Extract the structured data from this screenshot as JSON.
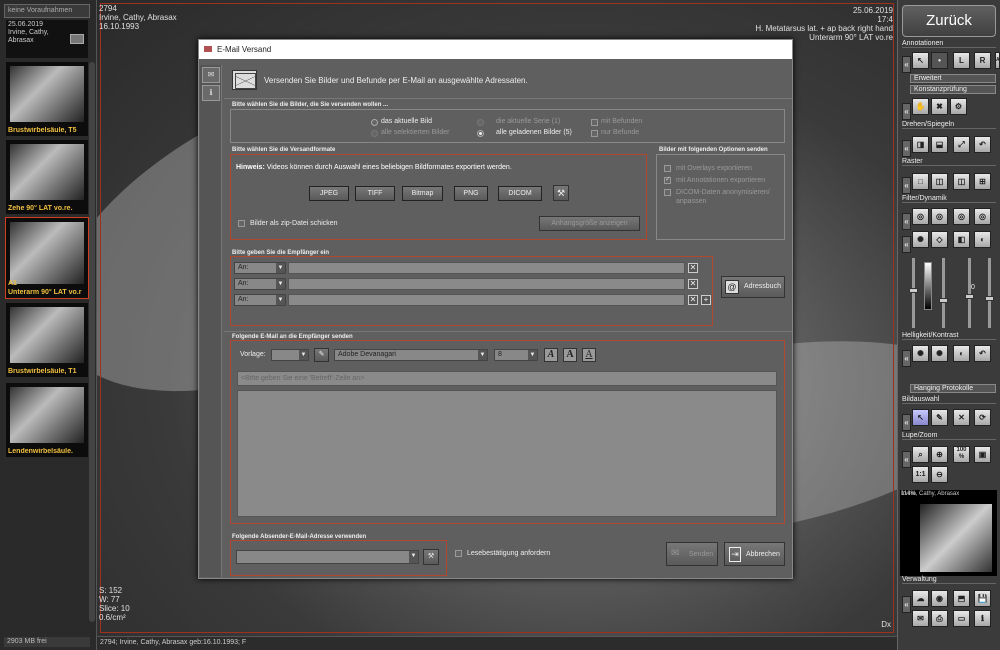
{
  "left": {
    "topbar": "keine Voraufnahmen",
    "patient_date": "25.06.2019",
    "patient_name": "Irvine, Cathy,",
    "patient_name2": "Abrasax",
    "thumbs": [
      {
        "label": "Brustwirbelsäule, T5"
      },
      {
        "label": "Zehe 90° LAT vo.re."
      },
      {
        "label": "Unterarm 90° LAT vo.r"
      },
      {
        "label": "Brustwirbelsäule, T1"
      },
      {
        "label": "Lendenwirbelsäule."
      }
    ],
    "thumb_a1": "A1",
    "free": "2903 MB frei"
  },
  "viewer": {
    "tl1": "2794",
    "tl2": "Irvine, Cathy, Abrasax",
    "tl3": "16.10.1993",
    "tr1": "25.06.2019",
    "tr2": "17:4",
    "tr3": "H. Metatarsus lat. + ap back right hand",
    "tr4": "Unterarm 90° LAT vo.re",
    "bl1": "S: 152",
    "bl2": "W: 77",
    "bl3": "Slice: 10",
    "bl4": "0.6/cm²",
    "br": "Dx"
  },
  "statusbar": "2794; Irvine, Cathy, Abrasax geb:16.10.1993; F",
  "right": {
    "back": "Zurück",
    "annotationen": "Annotationen",
    "erweitert": "Erweitert",
    "konstanz": "Konstanzprüfung",
    "drehen": "Drehen/Spiegeln",
    "raster": "Raster",
    "filter": "Filter/Dynamik",
    "slider_val": "0",
    "helligkeit": "Helligkeit/Kontrast",
    "hanging": "Hanging Protokolle",
    "bildauswahl": "Bildauswahl",
    "lupe": "Lupe/Zoom",
    "zoom100": "100 %",
    "zoom11": "1:1",
    "mini_name": "Irvine, Cathy, Abrasax",
    "mini_zoom": "114%",
    "verwaltung": "Verwaltung",
    "ann_L": "L",
    "ann_R": "R",
    "ann_ABC": "ABC"
  },
  "dialog": {
    "title": "E-Mail Versand",
    "header": "Versenden Sie Bilder und Befunde per E-Mail an ausgewählte Adressaten.",
    "images_group": "Bitte wählen Sie die Bilder, die Sie versenden wollen ...",
    "opt_current": "das aktuelle Bild",
    "opt_selected": "alle selektierten Bilder",
    "opt_series": "die aktuelle Serie (1)",
    "opt_all": "alle geladenen Bilder (5)",
    "opt_with_findings": "mit Befunden",
    "opt_only_findings": "nur Befunde",
    "format_group": "Bitte wählen Sie die Versandformate",
    "hint_bold": "Hinweis:",
    "hint": "Videos können durch Auswahl eines beliebigen Bildformates exportiert werden.",
    "formats": [
      "JPEG",
      "TIFF",
      "Bitmap",
      "PNG",
      "DICOM"
    ],
    "zip": "Bilder als zip-Datei schicken",
    "attach_size": "Anhangsgröße anzeigen",
    "options_group": "Bilder mit folgenden Optionen senden",
    "opt_overlays": "mit Overlays exportieren",
    "opt_annot": "mit Annotationen exportieren",
    "opt_anon": "DICOM-Daten anonymisieren/",
    "opt_anon2": "anpassen",
    "recipients_group": "Bitte geben Sie die Empfänger ein",
    "recipients": [
      {
        "type": "An:"
      },
      {
        "type": "An:"
      },
      {
        "type": "An:"
      }
    ],
    "addressbook": "Adressbuch",
    "email_group": "Folgende E-Mail an die Empfänger senden",
    "template_label": "Vorlage:",
    "font": "Adobe Devanagari",
    "font_size": "8",
    "subject_placeholder": "<Bitte geben Sie eine 'Betreff'-Zeile an>",
    "sender_group": "Folgende Absender-E-Mail-Adresse verwenden",
    "read_receipt": "Lesebestätigung anfordern",
    "send": "Senden",
    "cancel": "Abbrechen"
  }
}
